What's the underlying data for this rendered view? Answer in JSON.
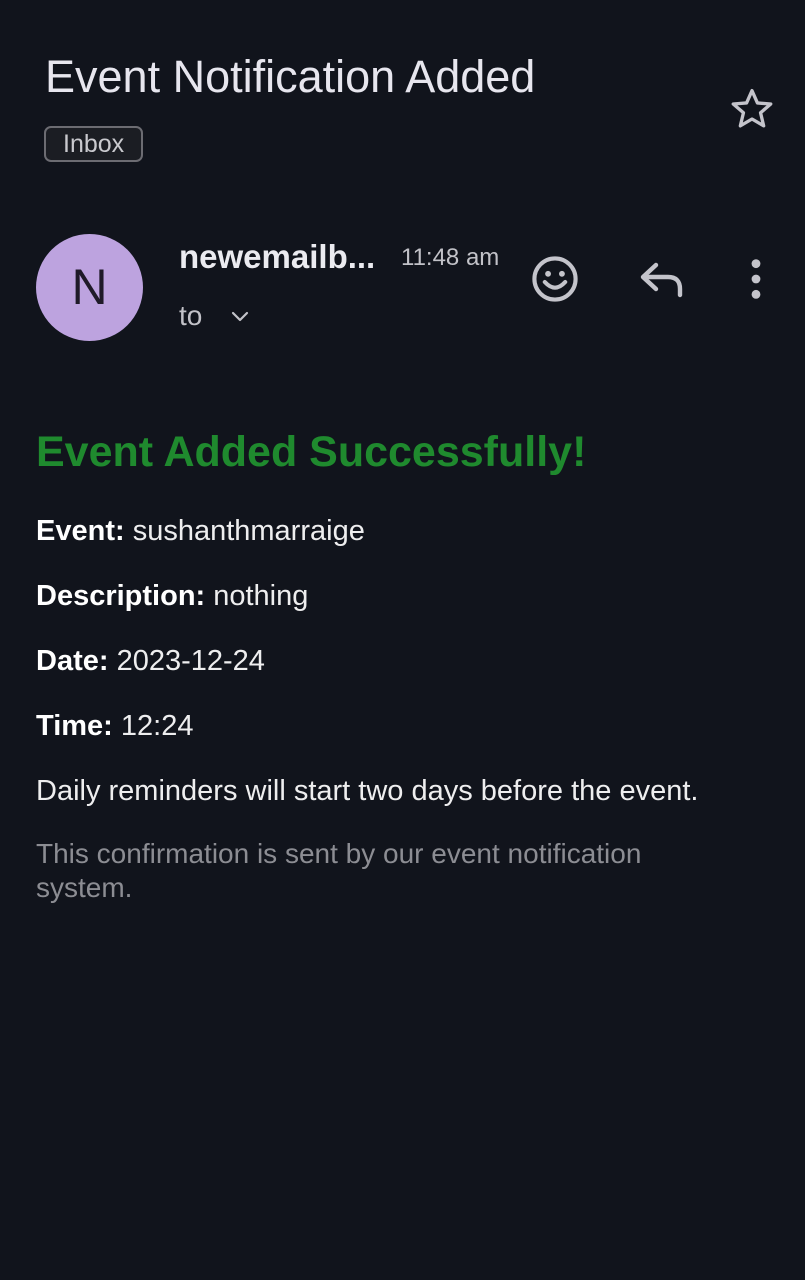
{
  "email": {
    "subject": "Event Notification Added",
    "label": "Inbox",
    "sender": {
      "avatar_initial": "N",
      "name": "newemailb...",
      "time": "11:48 am",
      "recipient_label": "to"
    },
    "icons": {
      "star": "star-icon",
      "emoji": "emoji-reaction-icon",
      "reply": "reply-icon",
      "more": "more-vert-icon",
      "expand": "chevron-down-icon"
    }
  },
  "message": {
    "headline": "Event Added Successfully!",
    "event_label": "Event:",
    "event_value": " sushanthmarraige",
    "description_label": "Description:",
    "description_value": " nothing",
    "date_label": "Date:",
    "date_value": " 2023-12-24",
    "time_label": "Time:",
    "time_value": " 12:24",
    "reminder_text": "Daily reminders will start two days before the event.",
    "footer_text": "This confirmation is sent by our event notification system."
  },
  "colors": {
    "background": "#11141c",
    "headline_green": "#1f8a2e",
    "avatar": "#bda3df",
    "muted_text": "#8c8d93"
  }
}
